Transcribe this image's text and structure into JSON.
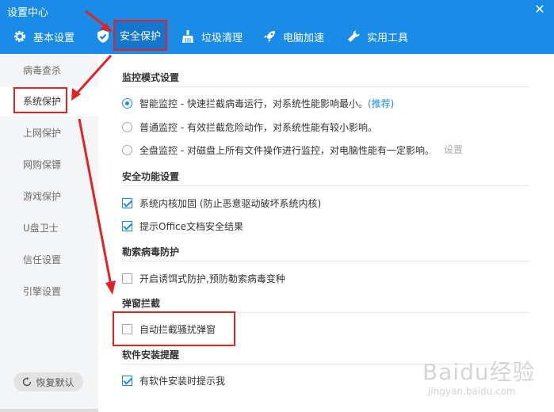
{
  "window": {
    "title": "设置中心",
    "close": "✕"
  },
  "tabs": [
    {
      "label": "基本设置",
      "icon": "gear-icon"
    },
    {
      "label": "安全保护",
      "icon": "shield-check-icon",
      "active": true
    },
    {
      "label": "垃圾清理",
      "icon": "broom-icon"
    },
    {
      "label": "电脑加速",
      "icon": "rocket-icon"
    },
    {
      "label": "实用工具",
      "icon": "wrench-icon"
    }
  ],
  "sidebar": {
    "items": [
      {
        "label": "病毒查杀"
      },
      {
        "label": "系统保护",
        "active": true
      },
      {
        "label": "上网保护"
      },
      {
        "label": "网购保镖"
      },
      {
        "label": "游戏保护"
      },
      {
        "label": "U盘卫士"
      },
      {
        "label": "信任设置"
      },
      {
        "label": "引擎设置"
      }
    ],
    "restore_label": "恢复默认"
  },
  "sections": {
    "monitor": {
      "title": "监控模式设置",
      "options": [
        {
          "text": "智能监控 - 快速拦截病毒运行，对系统性能影响最小。",
          "tag": "(推荐)",
          "selected": true
        },
        {
          "text": "普通监控 - 有效拦截危险动作，对系统性能有较小影响。",
          "selected": false
        },
        {
          "text": "全盘监控 - 对磁盘上所有文件操作进行监控，对电脑性能有一定影响。",
          "selected": false,
          "link": "设置"
        }
      ]
    },
    "security": {
      "title": "安全功能设置",
      "options": [
        {
          "text": "系统内核加固 (防止恶意驱动破坏系统内核)",
          "checked": true
        },
        {
          "text": "提示Office文档安全结果",
          "checked": true
        }
      ]
    },
    "ransomware": {
      "title": "勒索病毒防护",
      "options": [
        {
          "text": "开启诱饵式防护,预防勒索病毒变种",
          "checked": false
        }
      ]
    },
    "popup": {
      "title": "弹窗拦截",
      "options": [
        {
          "text": "自动拦截骚扰弹窗",
          "checked": false
        }
      ]
    },
    "install": {
      "title": "软件安装提醒",
      "options": [
        {
          "text": "有软件安装时提示我",
          "checked": true
        }
      ]
    }
  },
  "watermark": {
    "brand": "Baidu经验",
    "url": "jingyan.baidu.com"
  },
  "colors": {
    "accent": "#1a8be6",
    "annotation": "#e02323"
  }
}
